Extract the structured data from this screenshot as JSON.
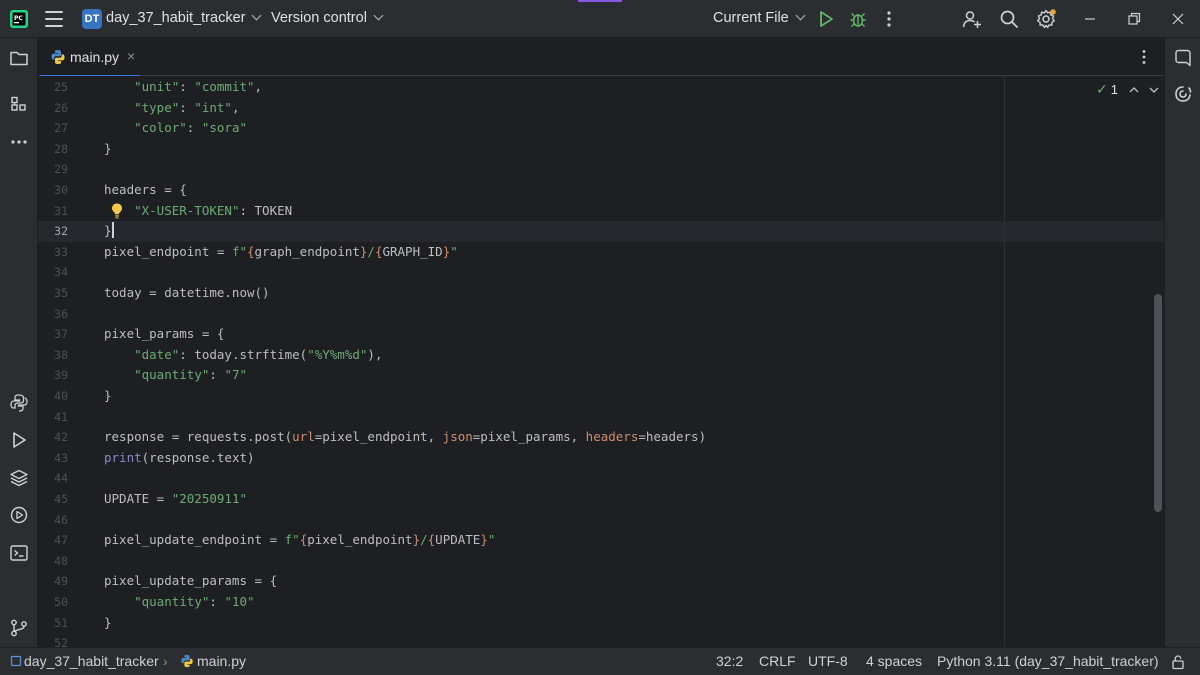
{
  "titlebar": {
    "project_badge": "DT",
    "project_name": "day_37_habit_tracker",
    "vcs_menu": "Version control",
    "run_config": "Current File",
    "accent_color": "#8a56e8"
  },
  "tab": {
    "file_name": "main.py",
    "close_glyph": "×",
    "icon": "python-file-icon"
  },
  "editor": {
    "inspection_count": "1",
    "current_line": 32,
    "lines": [
      {
        "n": "25",
        "tokens": [
          [
            "p",
            "    "
          ],
          [
            "s",
            "\"unit\""
          ],
          [
            "p",
            ": "
          ],
          [
            "s",
            "\"commit\""
          ],
          [
            "p",
            ","
          ]
        ]
      },
      {
        "n": "26",
        "tokens": [
          [
            "p",
            "    "
          ],
          [
            "s",
            "\"type\""
          ],
          [
            "p",
            ": "
          ],
          [
            "s",
            "\"int\""
          ],
          [
            "p",
            ","
          ]
        ]
      },
      {
        "n": "27",
        "tokens": [
          [
            "p",
            "    "
          ],
          [
            "s",
            "\"color\""
          ],
          [
            "p",
            ": "
          ],
          [
            "s",
            "\"sora\""
          ]
        ]
      },
      {
        "n": "28",
        "tokens": [
          [
            "p",
            "}"
          ]
        ]
      },
      {
        "n": "29",
        "tokens": []
      },
      {
        "n": "30",
        "tokens": [
          [
            "p",
            "headers = "
          ],
          [
            "br",
            "{"
          ]
        ]
      },
      {
        "n": "31",
        "tokens": [
          [
            "p",
            "    "
          ],
          [
            "s",
            "\"X-USER-TOKEN\""
          ],
          [
            "p",
            ": TOKEN"
          ]
        ]
      },
      {
        "n": "32",
        "tokens": [
          [
            "br",
            "}"
          ]
        ]
      },
      {
        "n": "33",
        "tokens": [
          [
            "p",
            "pixel_endpoint = "
          ],
          [
            "s",
            "f\""
          ],
          [
            "kw",
            "{"
          ],
          [
            "p",
            "graph_endpoint"
          ],
          [
            "kw",
            "}"
          ],
          [
            "s",
            "/"
          ],
          [
            "kw",
            "{"
          ],
          [
            "p",
            "GRAPH_ID"
          ],
          [
            "kw",
            "}"
          ],
          [
            "s",
            "\""
          ]
        ]
      },
      {
        "n": "34",
        "tokens": []
      },
      {
        "n": "35",
        "tokens": [
          [
            "p",
            "today = datetime.now()"
          ]
        ]
      },
      {
        "n": "36",
        "tokens": []
      },
      {
        "n": "37",
        "tokens": [
          [
            "p",
            "pixel_params = {"
          ]
        ]
      },
      {
        "n": "38",
        "tokens": [
          [
            "p",
            "    "
          ],
          [
            "s",
            "\"date\""
          ],
          [
            "p",
            ": today.strftime("
          ],
          [
            "s",
            "\"%Y%m%d\""
          ],
          [
            "p",
            "),"
          ]
        ]
      },
      {
        "n": "39",
        "tokens": [
          [
            "p",
            "    "
          ],
          [
            "s",
            "\"quantity\""
          ],
          [
            "p",
            ": "
          ],
          [
            "s",
            "\"7\""
          ]
        ]
      },
      {
        "n": "40",
        "tokens": [
          [
            "p",
            "}"
          ]
        ]
      },
      {
        "n": "41",
        "tokens": []
      },
      {
        "n": "42",
        "tokens": [
          [
            "p",
            "response = requests.post("
          ],
          [
            "kw",
            "url"
          ],
          [
            "p",
            "=pixel_endpoint, "
          ],
          [
            "kw",
            "json"
          ],
          [
            "p",
            "=pixel_params, "
          ],
          [
            "kw",
            "headers"
          ],
          [
            "p",
            "=headers)"
          ]
        ]
      },
      {
        "n": "43",
        "tokens": [
          [
            "b",
            "print"
          ],
          [
            "p",
            "(response.text)"
          ]
        ]
      },
      {
        "n": "44",
        "tokens": []
      },
      {
        "n": "45",
        "tokens": [
          [
            "p",
            "UPDATE = "
          ],
          [
            "s",
            "\"20250911\""
          ]
        ]
      },
      {
        "n": "46",
        "tokens": []
      },
      {
        "n": "47",
        "tokens": [
          [
            "p",
            "pixel_update_endpoint = "
          ],
          [
            "s",
            "f\""
          ],
          [
            "kw",
            "{"
          ],
          [
            "p",
            "pixel_endpoint"
          ],
          [
            "kw",
            "}"
          ],
          [
            "s",
            "/"
          ],
          [
            "kw",
            "{"
          ],
          [
            "p",
            "UPDATE"
          ],
          [
            "kw",
            "}"
          ],
          [
            "s",
            "\""
          ]
        ]
      },
      {
        "n": "48",
        "tokens": []
      },
      {
        "n": "49",
        "tokens": [
          [
            "p",
            "pixel_update_params = {"
          ]
        ]
      },
      {
        "n": "50",
        "tokens": [
          [
            "p",
            "    "
          ],
          [
            "s",
            "\"quantity\""
          ],
          [
            "p",
            ": "
          ],
          [
            "s",
            "\"10\""
          ]
        ]
      },
      {
        "n": "51",
        "tokens": [
          [
            "p",
            "}"
          ]
        ]
      },
      {
        "n": "52",
        "tokens": []
      }
    ]
  },
  "statusbar": {
    "breadcrumb_project": "day_37_habit_tracker",
    "breadcrumb_file": "main.py",
    "position": "32:2",
    "line_separator": "CRLF",
    "encoding": "UTF-8",
    "indent": "4 spaces",
    "interpreter": "Python 3.11 (day_37_habit_tracker)"
  }
}
